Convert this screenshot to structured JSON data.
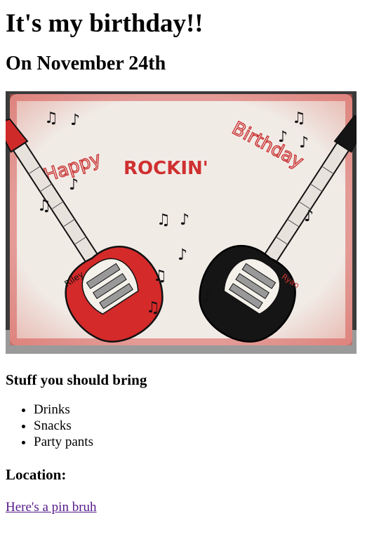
{
  "page": {
    "title": "It's my birthday!!",
    "date_heading": "On November 24th"
  },
  "cake": {
    "icons": [
      "music-note-icon",
      "guitar-icon"
    ],
    "writing": {
      "happy": "Happy",
      "rockin": "ROCKIN'",
      "birthday": "Birthday",
      "name_left": "Riley",
      "name_right": "Ryan"
    },
    "colors": {
      "frosting": "#f1ebe6",
      "red_accent": "#d42a2a",
      "black_guitar": "#151515",
      "background": "#3a3a3a"
    }
  },
  "bring": {
    "heading": "Stuff you should bring",
    "items": [
      "Drinks",
      "Snacks",
      "Party pants"
    ]
  },
  "location": {
    "heading": "Location:",
    "link_text": "Here's a pin bruh",
    "link_color": "#551a8b"
  }
}
